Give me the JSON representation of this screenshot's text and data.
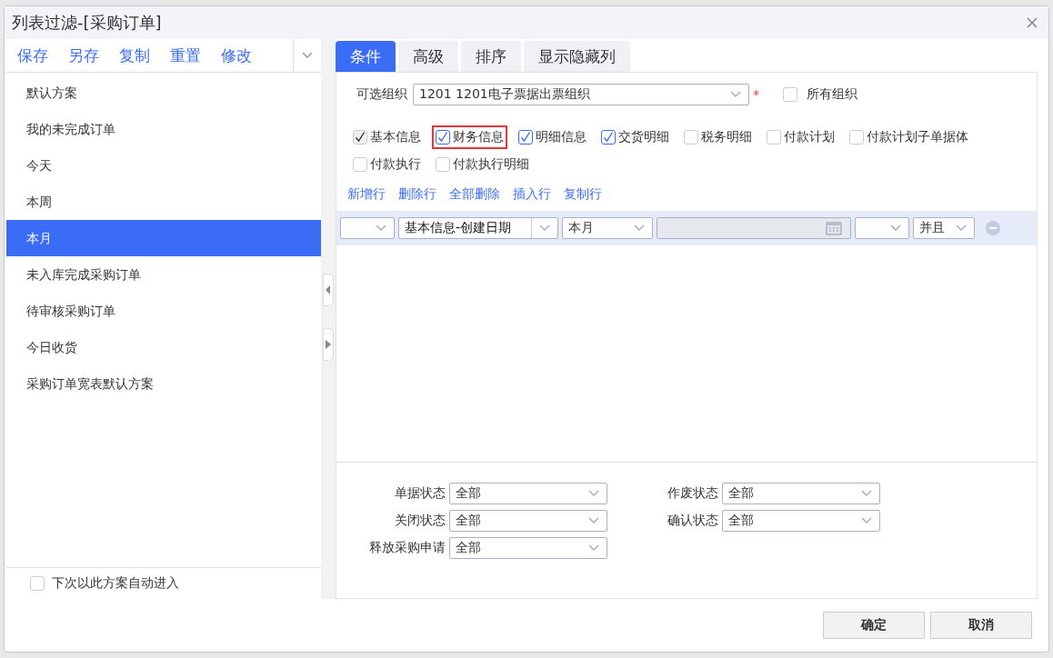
{
  "window": {
    "title": "列表过滤-[采购订单]"
  },
  "scheme_toolbar": [
    "保存",
    "另存",
    "复制",
    "重置",
    "修改"
  ],
  "schemes": [
    {
      "label": "默认方案",
      "selected": false
    },
    {
      "label": "我的未完成订单",
      "selected": false
    },
    {
      "label": "今天",
      "selected": false
    },
    {
      "label": "本周",
      "selected": false
    },
    {
      "label": "本月",
      "selected": true
    },
    {
      "label": "未入库完成采购订单",
      "selected": false
    },
    {
      "label": "待审核采购订单",
      "selected": false
    },
    {
      "label": "今日收货",
      "selected": false
    },
    {
      "label": "采购订单宽表默认方案",
      "selected": false
    }
  ],
  "auto_enter": {
    "label": "下次以此方案自动进入",
    "checked": false
  },
  "tabs": [
    {
      "label": "条件",
      "selected": true
    },
    {
      "label": "高级",
      "selected": false
    },
    {
      "label": "排序",
      "selected": false
    },
    {
      "label": "显示隐藏列",
      "selected": false
    }
  ],
  "org": {
    "label": "可选组织",
    "value": "1201 1201电子票据出票组织",
    "required_mark": "*",
    "all_orgs": {
      "label": "所有组织",
      "checked": false
    }
  },
  "sections": [
    {
      "label": "基本信息",
      "checked": true,
      "disabled": true,
      "highlighted": false
    },
    {
      "label": "财务信息",
      "checked": true,
      "disabled": false,
      "highlighted": true
    },
    {
      "label": "明细信息",
      "checked": true,
      "disabled": false,
      "highlighted": false
    },
    {
      "label": "交货明细",
      "checked": true,
      "disabled": false,
      "highlighted": false
    },
    {
      "label": "税务明细",
      "checked": false,
      "disabled": false,
      "highlighted": false
    },
    {
      "label": "付款计划",
      "checked": false,
      "disabled": false,
      "highlighted": false
    },
    {
      "label": "付款计划子单据体",
      "checked": false,
      "disabled": false,
      "highlighted": false
    },
    {
      "label": "付款执行",
      "checked": false,
      "disabled": false,
      "highlighted": false
    },
    {
      "label": "付款执行明细",
      "checked": false,
      "disabled": false,
      "highlighted": false
    }
  ],
  "row_actions": [
    "新增行",
    "删除行",
    "全部删除",
    "插入行",
    "复制行"
  ],
  "condition_row": {
    "field": "基本信息-创建日期",
    "operator": "本月",
    "logic": "并且"
  },
  "status_filters": [
    {
      "label": "单据状态",
      "value": "全部"
    },
    {
      "label": "作废状态",
      "value": "全部"
    },
    {
      "label": "关闭状态",
      "value": "全部"
    },
    {
      "label": "确认状态",
      "value": "全部"
    },
    {
      "label": "释放采购申请",
      "value": "全部"
    }
  ],
  "buttons": [
    "确定",
    "取消"
  ]
}
